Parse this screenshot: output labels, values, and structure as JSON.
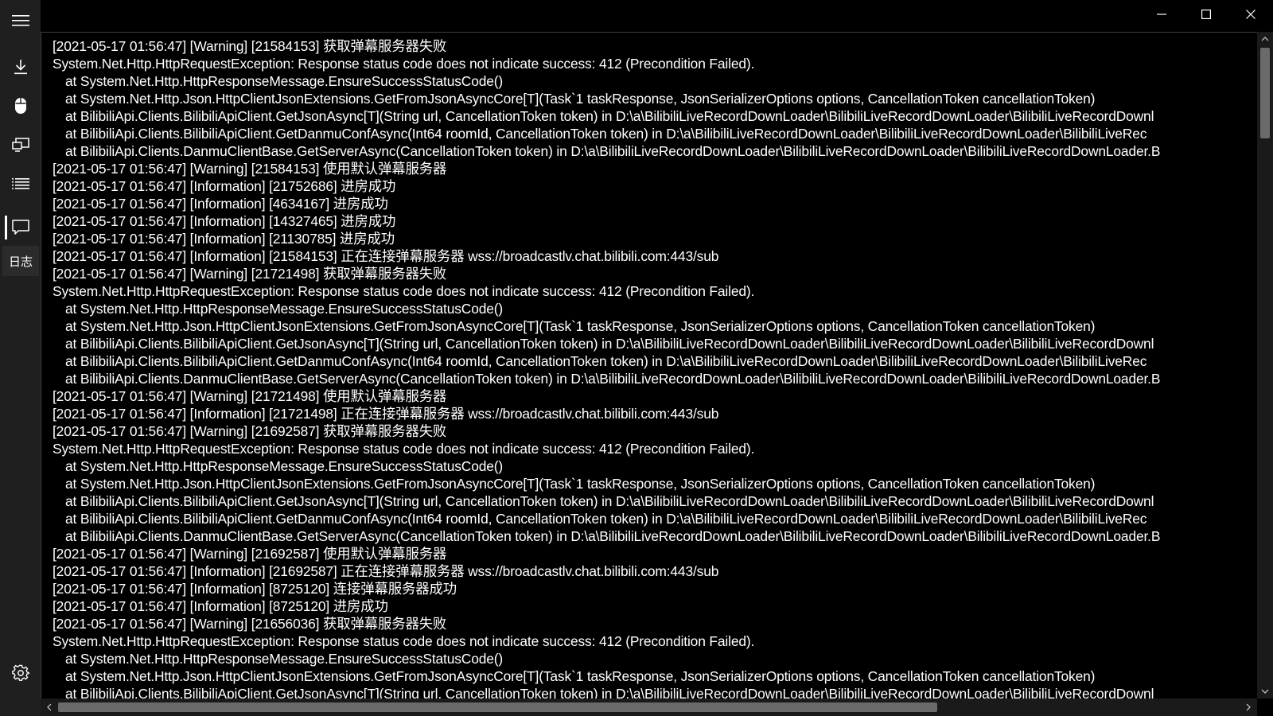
{
  "window": {
    "controls": {
      "minimize_icon": "minimize-icon",
      "maximize_icon": "maximize-icon",
      "close_icon": "close-icon"
    }
  },
  "sidebar": {
    "menu_icon": "hamburger-menu-icon",
    "items": [
      {
        "icon": "download-icon"
      },
      {
        "icon": "mouse-icon"
      },
      {
        "icon": "monitor-icon"
      },
      {
        "icon": "list-icon"
      },
      {
        "icon": "chat-icon",
        "selected": true
      }
    ],
    "logs_label": "日志",
    "settings_icon": "gear-icon"
  },
  "log": {
    "lines": [
      {
        "indent": false,
        "text": "[2021-05-17 01:56:47] [Warning] [21584153] 获取弹幕服务器失败"
      },
      {
        "indent": false,
        "text": "System.Net.Http.HttpRequestException: Response status code does not indicate success: 412 (Precondition Failed)."
      },
      {
        "indent": true,
        "text": "at System.Net.Http.HttpResponseMessage.EnsureSuccessStatusCode()"
      },
      {
        "indent": true,
        "text": "at System.Net.Http.Json.HttpClientJsonExtensions.GetFromJsonAsyncCore[T](Task`1 taskResponse, JsonSerializerOptions options, CancellationToken cancellationToken)"
      },
      {
        "indent": true,
        "text": "at BilibiliApi.Clients.BilibiliApiClient.GetJsonAsync[T](String url, CancellationToken token) in D:\\a\\BilibiliLiveRecordDownLoader\\BilibiliLiveRecordDownLoader\\BilibiliLiveRecordDownl"
      },
      {
        "indent": true,
        "text": "at BilibiliApi.Clients.BilibiliApiClient.GetDanmuConfAsync(Int64 roomId, CancellationToken token) in D:\\a\\BilibiliLiveRecordDownLoader\\BilibiliLiveRecordDownLoader\\BilibiliLiveRec"
      },
      {
        "indent": true,
        "text": "at BilibiliApi.Clients.DanmuClientBase.GetServerAsync(CancellationToken token) in D:\\a\\BilibiliLiveRecordDownLoader\\BilibiliLiveRecordDownLoader\\BilibiliLiveRecordDownLoader.B"
      },
      {
        "indent": false,
        "text": "[2021-05-17 01:56:47] [Warning] [21584153] 使用默认弹幕服务器"
      },
      {
        "indent": false,
        "text": "[2021-05-17 01:56:47] [Information] [21752686] 进房成功"
      },
      {
        "indent": false,
        "text": "[2021-05-17 01:56:47] [Information] [4634167] 进房成功"
      },
      {
        "indent": false,
        "text": "[2021-05-17 01:56:47] [Information] [14327465] 进房成功"
      },
      {
        "indent": false,
        "text": "[2021-05-17 01:56:47] [Information] [21130785] 进房成功"
      },
      {
        "indent": false,
        "text": "[2021-05-17 01:56:47] [Information] [21584153] 正在连接弹幕服务器 wss://broadcastlv.chat.bilibili.com:443/sub"
      },
      {
        "indent": false,
        "text": "[2021-05-17 01:56:47] [Warning] [21721498] 获取弹幕服务器失败"
      },
      {
        "indent": false,
        "text": "System.Net.Http.HttpRequestException: Response status code does not indicate success: 412 (Precondition Failed)."
      },
      {
        "indent": true,
        "text": "at System.Net.Http.HttpResponseMessage.EnsureSuccessStatusCode()"
      },
      {
        "indent": true,
        "text": "at System.Net.Http.Json.HttpClientJsonExtensions.GetFromJsonAsyncCore[T](Task`1 taskResponse, JsonSerializerOptions options, CancellationToken cancellationToken)"
      },
      {
        "indent": true,
        "text": "at BilibiliApi.Clients.BilibiliApiClient.GetJsonAsync[T](String url, CancellationToken token) in D:\\a\\BilibiliLiveRecordDownLoader\\BilibiliLiveRecordDownLoader\\BilibiliLiveRecordDownl"
      },
      {
        "indent": true,
        "text": "at BilibiliApi.Clients.BilibiliApiClient.GetDanmuConfAsync(Int64 roomId, CancellationToken token) in D:\\a\\BilibiliLiveRecordDownLoader\\BilibiliLiveRecordDownLoader\\BilibiliLiveRec"
      },
      {
        "indent": true,
        "text": "at BilibiliApi.Clients.DanmuClientBase.GetServerAsync(CancellationToken token) in D:\\a\\BilibiliLiveRecordDownLoader\\BilibiliLiveRecordDownLoader\\BilibiliLiveRecordDownLoader.B"
      },
      {
        "indent": false,
        "text": "[2021-05-17 01:56:47] [Warning] [21721498] 使用默认弹幕服务器"
      },
      {
        "indent": false,
        "text": "[2021-05-17 01:56:47] [Information] [21721498] 正在连接弹幕服务器 wss://broadcastlv.chat.bilibili.com:443/sub"
      },
      {
        "indent": false,
        "text": "[2021-05-17 01:56:47] [Warning] [21692587] 获取弹幕服务器失败"
      },
      {
        "indent": false,
        "text": "System.Net.Http.HttpRequestException: Response status code does not indicate success: 412 (Precondition Failed)."
      },
      {
        "indent": true,
        "text": "at System.Net.Http.HttpResponseMessage.EnsureSuccessStatusCode()"
      },
      {
        "indent": true,
        "text": "at System.Net.Http.Json.HttpClientJsonExtensions.GetFromJsonAsyncCore[T](Task`1 taskResponse, JsonSerializerOptions options, CancellationToken cancellationToken)"
      },
      {
        "indent": true,
        "text": "at BilibiliApi.Clients.BilibiliApiClient.GetJsonAsync[T](String url, CancellationToken token) in D:\\a\\BilibiliLiveRecordDownLoader\\BilibiliLiveRecordDownLoader\\BilibiliLiveRecordDownl"
      },
      {
        "indent": true,
        "text": "at BilibiliApi.Clients.BilibiliApiClient.GetDanmuConfAsync(Int64 roomId, CancellationToken token) in D:\\a\\BilibiliLiveRecordDownLoader\\BilibiliLiveRecordDownLoader\\BilibiliLiveRec"
      },
      {
        "indent": true,
        "text": "at BilibiliApi.Clients.DanmuClientBase.GetServerAsync(CancellationToken token) in D:\\a\\BilibiliLiveRecordDownLoader\\BilibiliLiveRecordDownLoader\\BilibiliLiveRecordDownLoader.B"
      },
      {
        "indent": false,
        "text": "[2021-05-17 01:56:47] [Warning] [21692587] 使用默认弹幕服务器"
      },
      {
        "indent": false,
        "text": "[2021-05-17 01:56:47] [Information] [21692587] 正在连接弹幕服务器 wss://broadcastlv.chat.bilibili.com:443/sub"
      },
      {
        "indent": false,
        "text": "[2021-05-17 01:56:47] [Information] [8725120] 连接弹幕服务器成功"
      },
      {
        "indent": false,
        "text": "[2021-05-17 01:56:47] [Information] [8725120] 进房成功"
      },
      {
        "indent": false,
        "text": "[2021-05-17 01:56:47] [Warning] [21656036] 获取弹幕服务器失败"
      },
      {
        "indent": false,
        "text": "System.Net.Http.HttpRequestException: Response status code does not indicate success: 412 (Precondition Failed)."
      },
      {
        "indent": true,
        "text": "at System.Net.Http.HttpResponseMessage.EnsureSuccessStatusCode()"
      },
      {
        "indent": true,
        "text": "at System.Net.Http.Json.HttpClientJsonExtensions.GetFromJsonAsyncCore[T](Task`1 taskResponse, JsonSerializerOptions options, CancellationToken cancellationToken)"
      },
      {
        "indent": true,
        "text": "at BilibiliApi.Clients.BilibiliApiClient.GetJsonAsync[T](String url, CancellationToken token) in D:\\a\\BilibiliLiveRecordDownLoader\\BilibiliLiveRecordDownLoader\\BilibiliLiveRecordDownl"
      }
    ]
  },
  "scrollbars": {
    "vertical": {
      "up_icon": "scroll-up-arrow-icon",
      "down_icon": "scroll-down-arrow-icon"
    },
    "horizontal": {
      "left_icon": "scroll-left-arrow-icon",
      "right_icon": "scroll-right-arrow-icon"
    }
  }
}
